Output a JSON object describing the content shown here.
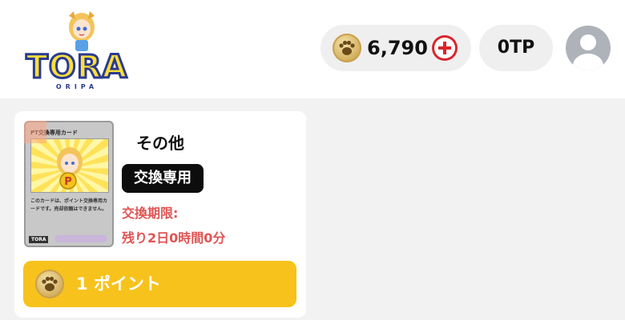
{
  "header": {
    "logo": {
      "text": "TORA",
      "subtitle": "ORIPA"
    },
    "coins": {
      "icon": "paw-coin-icon",
      "value": "6,790",
      "add_icon": "plus-circle-icon"
    },
    "tp": {
      "value": "0TP"
    },
    "avatar": {
      "icon": "user-avatar-icon"
    }
  },
  "item": {
    "card_image": {
      "header_text": "PT交換専用カード",
      "body_text": "このカードは、ポイント交換専用カードです。売却依頼はできません。",
      "footer_text": "TORA"
    },
    "title": "その他",
    "badge": "交換専用",
    "deadline_label": "交換期限:",
    "deadline_value": "残り2日0時間0分",
    "button": {
      "icon": "paw-coin-icon",
      "label": "1 ポイント"
    }
  },
  "colors": {
    "accent_yellow": "#f7c21b",
    "deadline_red": "#e05454",
    "badge_black": "#0d0d0d",
    "add_red": "#d8262c"
  }
}
